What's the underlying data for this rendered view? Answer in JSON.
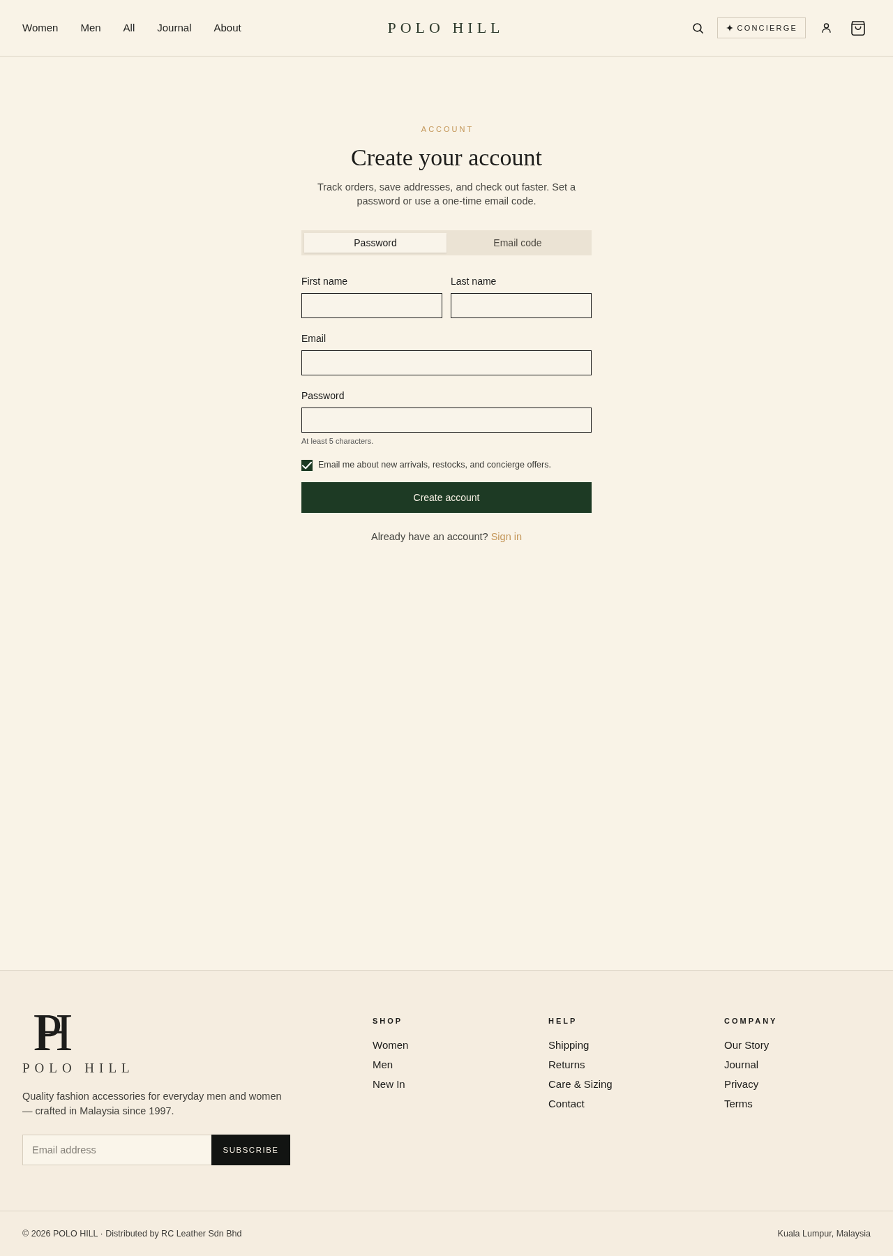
{
  "header": {
    "nav": [
      "Women",
      "Men",
      "All",
      "Journal",
      "About"
    ],
    "logo": "POLO HILL",
    "concierge": "CONCIERGE"
  },
  "account": {
    "eyebrow": "ACCOUNT",
    "title": "Create your account",
    "intro": "Track orders, save addresses, and check out faster. Set a password or use a one-time email code.",
    "tabs": [
      {
        "label": "Password",
        "selected": true
      },
      {
        "label": "Email code",
        "selected": false
      }
    ],
    "rows": [
      {
        "fields": [
          {
            "label": "First name"
          },
          {
            "label": "Last name"
          }
        ]
      },
      {
        "fields": [
          {
            "label": "Email"
          }
        ]
      },
      {
        "fields": [
          {
            "label": "Password",
            "hint": "At least 5 characters."
          }
        ]
      }
    ],
    "consent": {
      "label": "Email me about new arrivals, restocks, and concierge offers.",
      "checked": true
    },
    "submit": "Create account",
    "signin": {
      "prompt": "Already have an account?",
      "link": "Sign in"
    }
  },
  "footer": {
    "brand": {
      "monogram": "PH",
      "name": "POLO HILL",
      "tagline": "Quality fashion accessories for everyday men and women — crafted in Malaysia since 1997."
    },
    "newsletter": {
      "placeholder": "Email address",
      "button": "SUBSCRIBE"
    },
    "columns": [
      {
        "heading": "SHOP",
        "links": [
          "Women",
          "Men",
          "New In"
        ]
      },
      {
        "heading": "HELP",
        "links": [
          "Shipping",
          "Returns",
          "Care & Sizing",
          "Contact"
        ]
      },
      {
        "heading": "COMPANY",
        "links": [
          "Our Story",
          "Journal",
          "Privacy",
          "Terms"
        ]
      }
    ],
    "bottom": {
      "copyright": "© 2026 POLO HILL · Distributed by RC Leather Sdn Bhd",
      "location": "Kuala Lumpur, Malaysia"
    }
  }
}
